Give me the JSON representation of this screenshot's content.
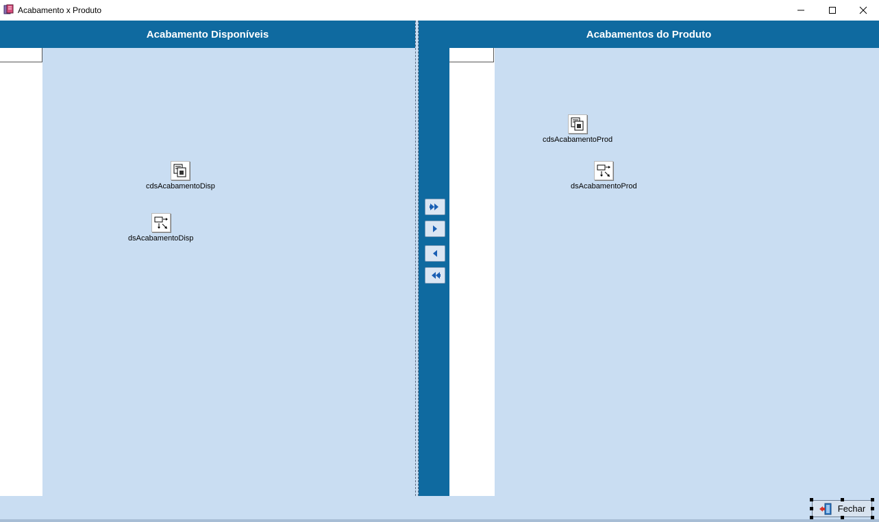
{
  "window": {
    "title": "Acabamento x Produto",
    "controls": [
      "minimize-icon",
      "maximize-icon",
      "close-icon"
    ]
  },
  "left_panel": {
    "header": "Acabamento Disponíveis",
    "components": [
      {
        "name": "cdsAcabamentoDisp",
        "icon": "client-dataset-icon"
      },
      {
        "name": "dsAcabamentoDisp",
        "icon": "datasource-icon"
      }
    ]
  },
  "right_panel": {
    "header": "Acabamentos do Produto",
    "components": [
      {
        "name": "cdsAcabamentoProd",
        "icon": "client-dataset-icon"
      },
      {
        "name": "dsAcabamentoProd",
        "icon": "datasource-icon"
      }
    ]
  },
  "move_buttons": [
    {
      "action": "move-all-right",
      "icon": "double-arrow-right-icon"
    },
    {
      "action": "move-right",
      "icon": "arrow-right-icon"
    },
    {
      "action": "move-left",
      "icon": "arrow-left-icon"
    },
    {
      "action": "move-all-left",
      "icon": "double-arrow-left-icon"
    }
  ],
  "footer": {
    "close_label": "Fechar",
    "close_icon": "exit-door-icon"
  },
  "colors": {
    "header_blue": "#0f6aa0",
    "form_background": "#c9ddf2",
    "arrow_blue": "#1a5fb4"
  }
}
